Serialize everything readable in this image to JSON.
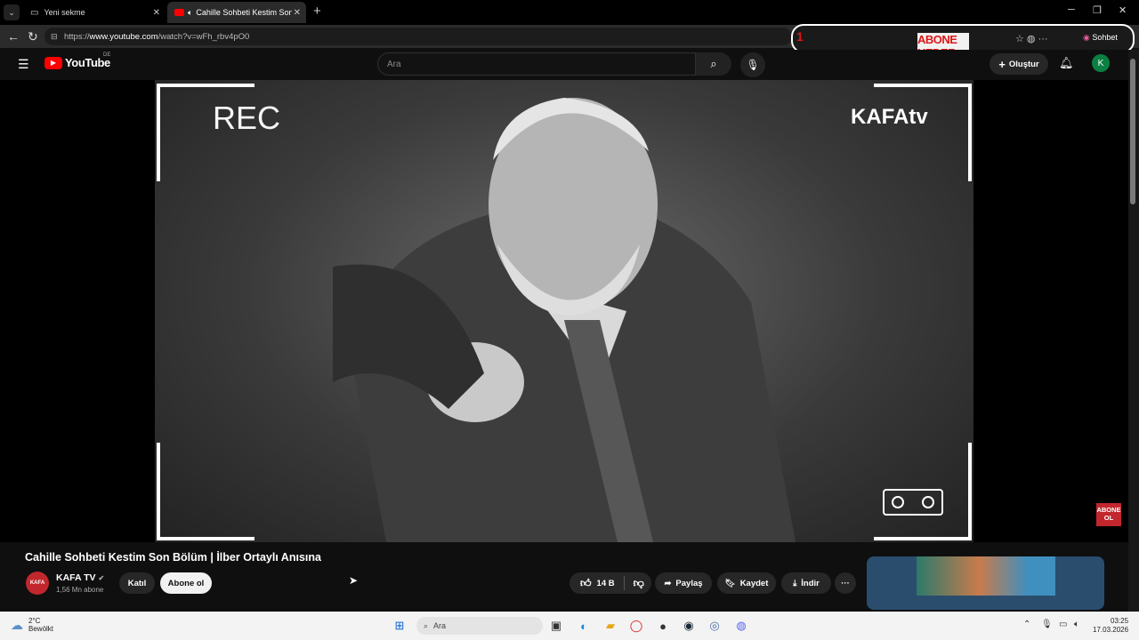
{
  "browser": {
    "tabs": [
      {
        "label": "Yeni sekme"
      },
      {
        "label": "Cahille Sohbeti Kestim Son Bölüm"
      }
    ],
    "url_prefix": "https://",
    "url_host": "www.youtube.com",
    "url_path": "/watch?v=wFh_rbv4pO0",
    "overlay_number": "1",
    "overlay_text": "ABONE HEDEF",
    "chat_label": "Sohbet"
  },
  "youtube": {
    "logo_text": "YouTube",
    "region": "DE",
    "search_placeholder": "Ara",
    "create_label": "Oluştur",
    "avatar_letter": "K"
  },
  "video": {
    "rec_label": "REC",
    "channel_logo_text": "KAFAtv",
    "abone_badge": "ABONE OL",
    "title": "Cahille Sohbeti Kestim Son Bölüm | İlber Ortaylı Anısına",
    "channel_name": "KAFA TV",
    "subscribers": "1,56 Mn abone",
    "join_label": "Katıl",
    "subscribe_label": "Abone ol",
    "likes": "14 B",
    "share_label": "Paylaş",
    "save_label": "Kaydet",
    "download_label": "İndir",
    "channel_avatar_text": "KAFA"
  },
  "taskbar": {
    "temperature": "2°C",
    "weather_desc": "Bewölkt",
    "search_placeholder": "Ara",
    "time": "03:25",
    "date": "17.03.2026"
  }
}
